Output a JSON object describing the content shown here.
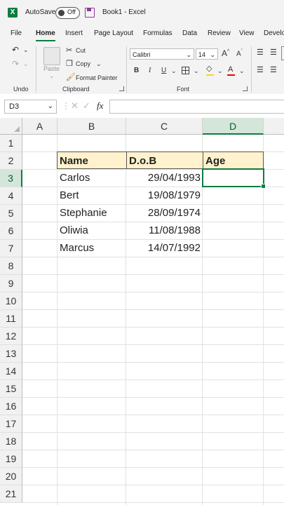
{
  "titlebar": {
    "app_logo": "X",
    "autosave_label": "AutoSave",
    "autosave_state": "Off",
    "title": "Book1 - Excel"
  },
  "tabs": [
    "File",
    "Home",
    "Insert",
    "Page Layout",
    "Formulas",
    "Data",
    "Review",
    "View",
    "Develo"
  ],
  "active_tab": "Home",
  "ribbon": {
    "undo_group": "Undo",
    "clipboard": {
      "paste": "Paste",
      "cut": "Cut",
      "copy": "Copy",
      "format_painter": "Format Painter",
      "label": "Clipboard"
    },
    "font": {
      "name": "Calibri",
      "size": "14",
      "bold": "B",
      "italic": "I",
      "underline": "U",
      "color_letter": "A",
      "label": "Font"
    }
  },
  "formula_bar": {
    "name_box": "D3",
    "fx": "fx",
    "content": ""
  },
  "sheet": {
    "columns": [
      "A",
      "B",
      "C",
      "D"
    ],
    "rows": [
      "1",
      "2",
      "3",
      "4",
      "5",
      "6",
      "7",
      "8",
      "9",
      "10",
      "11",
      "12",
      "13",
      "14",
      "15",
      "16",
      "17",
      "18",
      "19",
      "20",
      "21"
    ],
    "headers": {
      "name": "Name",
      "dob": "D.o.B",
      "age": "Age"
    },
    "records": [
      {
        "name": "Carlos",
        "dob": "29/04/1993"
      },
      {
        "name": "Bert",
        "dob": "19/08/1979"
      },
      {
        "name": "Stephanie",
        "dob": "28/09/1974"
      },
      {
        "name": "Oliwia",
        "dob": "11/08/1988"
      },
      {
        "name": "Marcus",
        "dob": "14/07/1992"
      }
    ],
    "active_cell": "D3"
  },
  "colors": {
    "accent": "#107c41",
    "header_fill": "#fff2cc",
    "autosave_icon": "#8e3a9c"
  }
}
